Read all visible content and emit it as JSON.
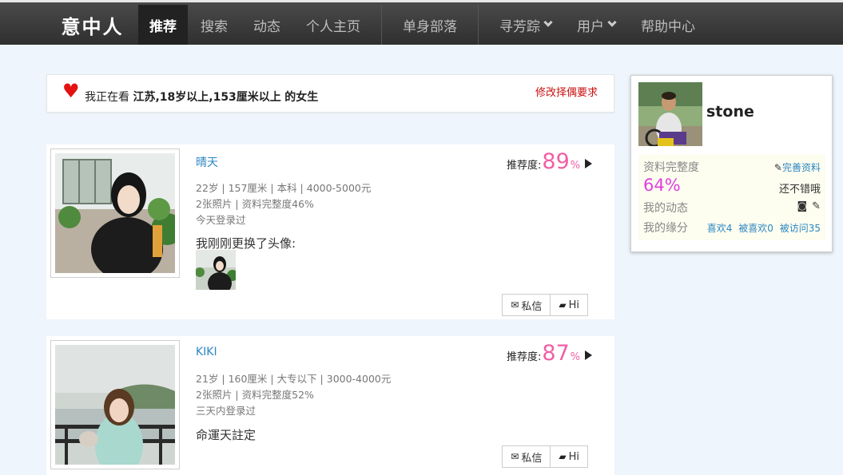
{
  "nav": {
    "brand": "意中人",
    "items": [
      {
        "label": "推荐"
      },
      {
        "label": "搜索"
      },
      {
        "label": "动态"
      },
      {
        "label": "个人主页"
      },
      {
        "label": "单身部落"
      },
      {
        "label": "寻芳踪"
      },
      {
        "label": "用户"
      },
      {
        "label": "帮助中心"
      }
    ]
  },
  "filter": {
    "prefix": "我正在看",
    "criteria": "江苏,18岁以上,153厘米以上",
    "suffix": "的女生",
    "edit_link": "修改择偶要求"
  },
  "profiles": [
    {
      "name": "晴天",
      "details": "22岁 | 157厘米 | 本科 | 4000-5000元",
      "photos": "2张照片 | 资料完整度46%",
      "login": "今天登录过",
      "score_label": "推荐度:",
      "score": "89",
      "score_unit": "%",
      "status": "我刚刚更换了头像:",
      "msg_label": "私信",
      "hi_label": "Hi"
    },
    {
      "name": "KIKI",
      "details": "21岁 | 160厘米 | 大专以下 | 3000-4000元",
      "photos": "2张照片 | 资料完整度52%",
      "login": "三天内登录过",
      "score_label": "推荐度:",
      "score": "87",
      "score_unit": "%",
      "status": "命運天註定",
      "msg_label": "私信",
      "hi_label": "Hi"
    }
  ],
  "sidebar": {
    "username": "stone",
    "completeness_label": "资料完整度",
    "improve_link": "完善资料",
    "completeness_value": "64%",
    "completeness_comment": "还不错哦",
    "activity_label": "我的动态",
    "fate_label": "我的缘分",
    "likes": "喜欢4",
    "liked_by": "被喜欢0",
    "visited": "被访问35"
  }
}
